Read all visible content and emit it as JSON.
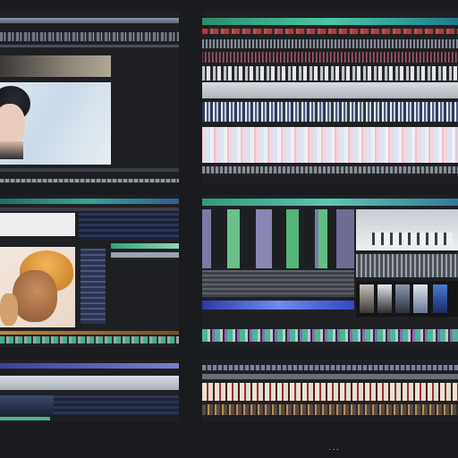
{
  "app": {
    "title": ""
  },
  "panels": [
    {
      "id": "video-editor-topleft",
      "kind": "preview-window"
    },
    {
      "id": "timeline-topright",
      "kind": "timeline-window"
    },
    {
      "id": "media-browser-middleleft",
      "kind": "media-window"
    },
    {
      "id": "multicam-middleright",
      "kind": "multicam-window"
    },
    {
      "id": "track-list-bottomleft",
      "kind": "tracks-window"
    },
    {
      "id": "titles-bottomright",
      "kind": "titles-window"
    }
  ],
  "footer": {
    "glyph": "··· "
  },
  "icons": [
    "close-icon",
    "play-icon"
  ],
  "colors": {
    "background": "#1a1b1e",
    "panel": "#1f2023",
    "accent_green": "#49c9a4",
    "accent_blue": "#3048c6",
    "accent_red": "#b23b3b"
  }
}
